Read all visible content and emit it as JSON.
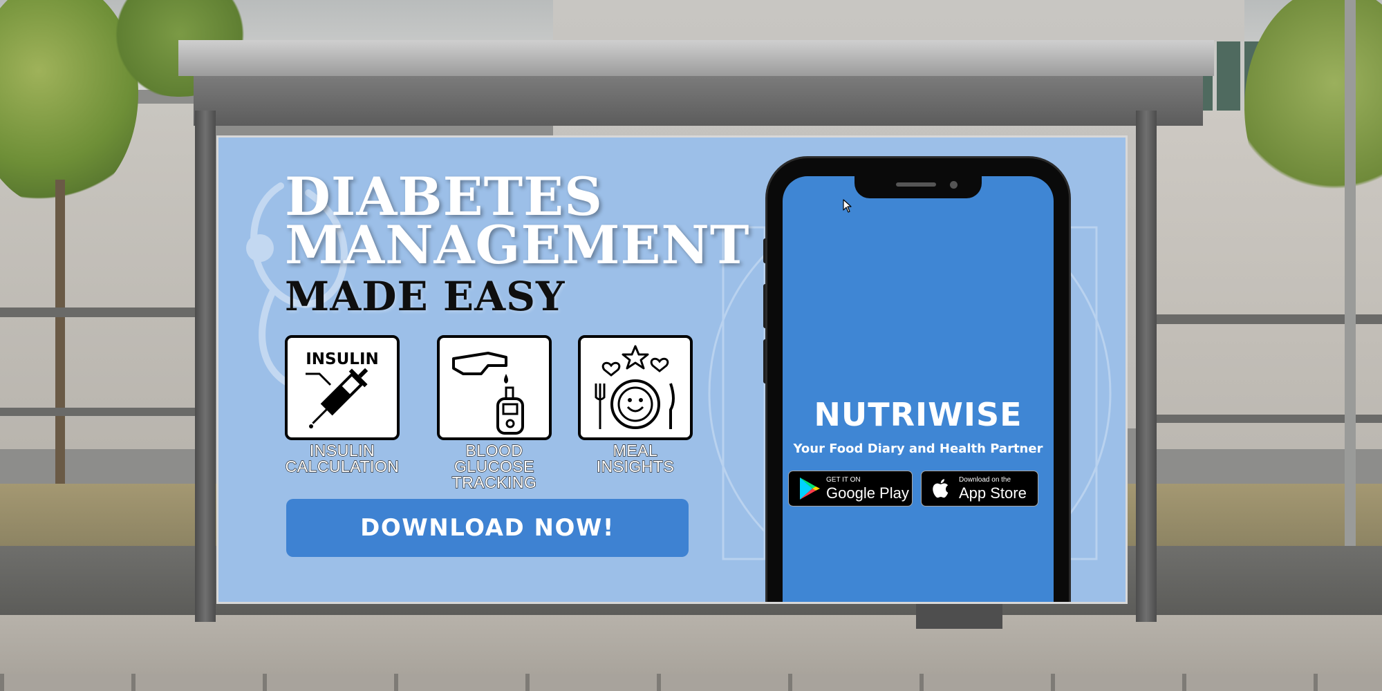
{
  "billboard": {
    "headline": {
      "line1": "DIABETES",
      "line2": "MANAGEMENT",
      "line3": "MADE EASY"
    },
    "features": [
      {
        "icon": "insulin-syringe-icon",
        "icon_text": "INSULIN",
        "label_lines": [
          "INSULIN",
          "CALCULATION"
        ]
      },
      {
        "icon": "glucose-meter-icon",
        "label_lines": [
          "BLOOD",
          "GLUCOSE",
          "TRACKING"
        ]
      },
      {
        "icon": "meal-plate-icon",
        "label_lines": [
          "MEAL",
          "INSIGHTS"
        ]
      }
    ],
    "cta_label": "DOWNLOAD NOW!",
    "colors": {
      "background": "#9cbfe8",
      "button": "#3e82d2",
      "phone_screen": "#3f86d4"
    }
  },
  "phone": {
    "app_name": "NUTRIWISE",
    "tagline": "Your Food Diary and Health Partner",
    "google_play": {
      "small": "GET IT ON",
      "big": "Google Play",
      "icon": "google-play-icon"
    },
    "app_store": {
      "small": "Download on the",
      "big": "App Store",
      "icon": "apple-icon"
    }
  }
}
